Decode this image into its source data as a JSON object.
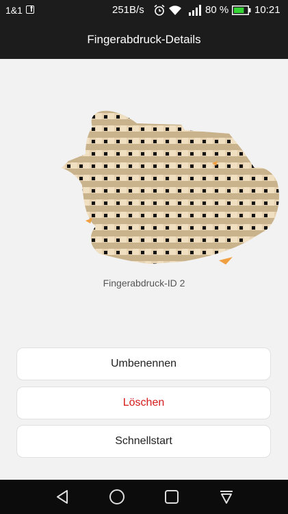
{
  "status_bar": {
    "carrier": "1&1",
    "speed": "251B/s",
    "battery_percent": "80 %",
    "battery_level": 0.8,
    "time": "10:21",
    "icons": [
      "facebook-notification-icon",
      "alarm-icon",
      "wifi-icon",
      "signal-icon",
      "battery-icon"
    ]
  },
  "header": {
    "title": "Fingerabdruck-Details"
  },
  "fingerprint": {
    "label": "Fingerabdruck-ID 2"
  },
  "actions": {
    "rename": "Umbenennen",
    "delete": "Löschen",
    "quick_start": "Schnellstart"
  },
  "nav": {
    "icons": [
      "back-icon",
      "home-icon",
      "recents-icon",
      "notification-shade-icon"
    ]
  },
  "colors": {
    "delete": "#d51a1a",
    "bar": "#1c1c1c",
    "background": "#f2f2f2"
  }
}
